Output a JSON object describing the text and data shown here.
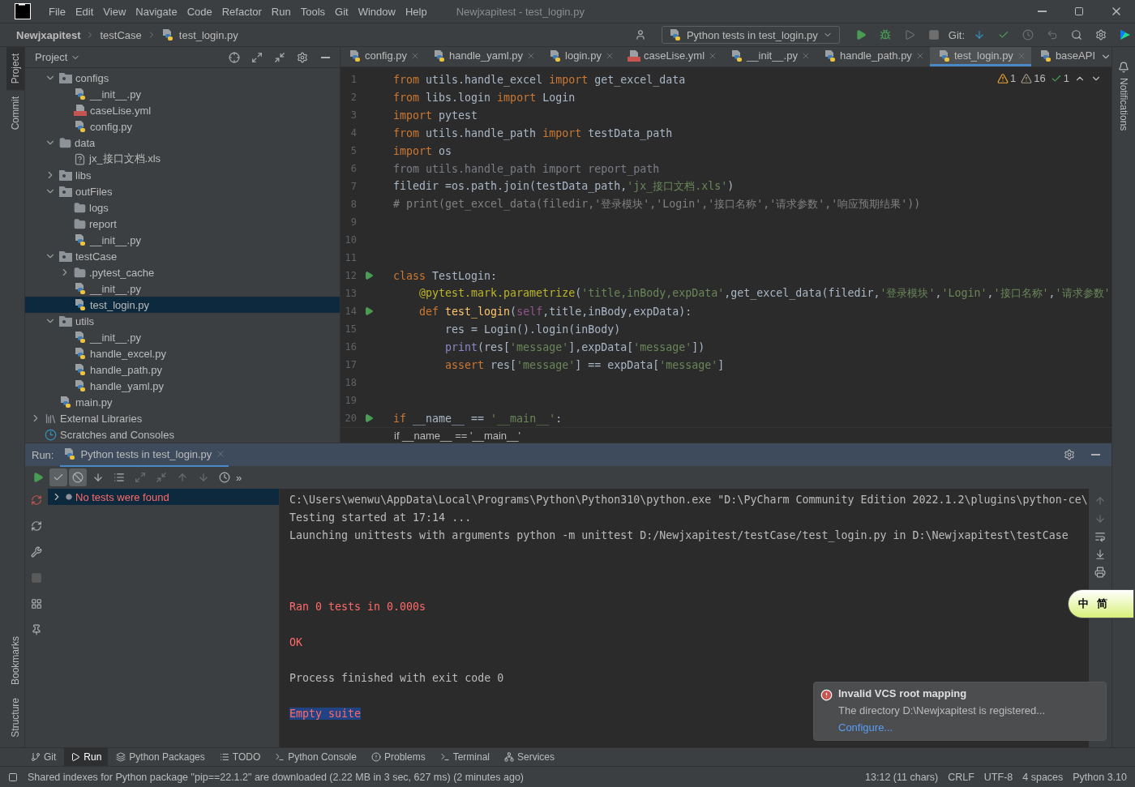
{
  "title_bar": {
    "menus": [
      "File",
      "Edit",
      "View",
      "Navigate",
      "Code",
      "Refactor",
      "Run",
      "Tools",
      "Git",
      "Window",
      "Help"
    ],
    "title": "Newjxapitest - test_login.py"
  },
  "nav_bar": {
    "breadcrumbs": [
      "Newjxapitest",
      "testCase",
      "test_login.py"
    ],
    "run_config": "Python tests in test_login.py",
    "git_label": "Git:"
  },
  "left_strip": {
    "top": [
      {
        "label": "Project",
        "selected": true
      },
      {
        "label": "Commit",
        "selected": false
      }
    ],
    "bottom": [
      {
        "label": "Bookmarks",
        "selected": false
      },
      {
        "label": "Structure",
        "selected": false
      }
    ]
  },
  "project_panel": {
    "title": "Project",
    "tree": [
      {
        "label": "configs",
        "kind": "package",
        "expanded": true,
        "selected": false,
        "children": [
          {
            "label": "__init__.py",
            "kind": "py",
            "selected": false
          },
          {
            "label": "caseLise.yml",
            "kind": "yml",
            "selected": false
          },
          {
            "label": "config.py",
            "kind": "py",
            "selected": false
          }
        ]
      },
      {
        "label": "data",
        "kind": "folder",
        "expanded": true,
        "selected": false,
        "children": [
          {
            "label": "jx_接口文档.xls",
            "kind": "unknown",
            "selected": false
          }
        ]
      },
      {
        "label": "libs",
        "kind": "package",
        "expanded": false,
        "selected": false
      },
      {
        "label": "outFiles",
        "kind": "package",
        "expanded": true,
        "selected": false,
        "children": [
          {
            "label": "logs",
            "kind": "folder",
            "selected": false
          },
          {
            "label": "report",
            "kind": "folder",
            "selected": false
          },
          {
            "label": "__init__.py",
            "kind": "py",
            "selected": false
          }
        ]
      },
      {
        "label": "testCase",
        "kind": "package",
        "expanded": true,
        "selected": false,
        "children": [
          {
            "label": ".pytest_cache",
            "kind": "folder",
            "expanded": false,
            "selected": false
          },
          {
            "label": "__init__.py",
            "kind": "py",
            "selected": false
          },
          {
            "label": "test_login.py",
            "kind": "py",
            "selected": true
          }
        ]
      },
      {
        "label": "utils",
        "kind": "package",
        "expanded": true,
        "selected": false,
        "children": [
          {
            "label": "__init__.py",
            "kind": "py",
            "selected": false
          },
          {
            "label": "handle_excel.py",
            "kind": "py",
            "selected": false
          },
          {
            "label": "handle_path.py",
            "kind": "py",
            "selected": false
          },
          {
            "label": "handle_yaml.py",
            "kind": "py",
            "selected": false
          }
        ]
      },
      {
        "label": "main.py",
        "kind": "py",
        "selected": false
      }
    ],
    "extras": [
      {
        "label": "External Libraries",
        "kind": "libs",
        "expanded": false
      },
      {
        "label": "Scratches and Consoles",
        "kind": "scratch"
      }
    ]
  },
  "editor": {
    "tabs": [
      {
        "label": "config.py",
        "kind": "py",
        "selected": false
      },
      {
        "label": "handle_yaml.py",
        "kind": "py",
        "selected": false
      },
      {
        "label": "login.py",
        "kind": "py",
        "selected": false
      },
      {
        "label": "caseLise.yml",
        "kind": "yml",
        "selected": false
      },
      {
        "label": "__init__.py",
        "kind": "py",
        "selected": false
      },
      {
        "label": "handle_path.py",
        "kind": "py",
        "selected": false
      },
      {
        "label": "test_login.py",
        "kind": "py",
        "selected": true
      },
      {
        "label": "baseAPI",
        "kind": "py",
        "selected": false
      }
    ],
    "inspections": [
      {
        "kind": "warning",
        "count": "1"
      },
      {
        "kind": "weak",
        "count": "16"
      },
      {
        "kind": "typo",
        "count": "1"
      }
    ],
    "lines": [
      {
        "number": "1",
        "run": false,
        "tokens": [
          {
            "kind": "kw",
            "text": "from"
          },
          {
            "kind": "plain",
            "text": " utils.handle_excel "
          },
          {
            "kind": "kw",
            "text": "import"
          },
          {
            "kind": "plain",
            "text": " get_excel_data"
          }
        ]
      },
      {
        "number": "2",
        "run": false,
        "tokens": [
          {
            "kind": "kw",
            "text": "from"
          },
          {
            "kind": "plain",
            "text": " libs.login "
          },
          {
            "kind": "kw",
            "text": "import"
          },
          {
            "kind": "plain",
            "text": " Login"
          }
        ]
      },
      {
        "number": "3",
        "run": false,
        "tokens": [
          {
            "kind": "kw",
            "text": "import"
          },
          {
            "kind": "plain",
            "text": " pytest"
          }
        ]
      },
      {
        "number": "4",
        "run": false,
        "tokens": [
          {
            "kind": "kw",
            "text": "from"
          },
          {
            "kind": "plain",
            "text": " utils.handle_path "
          },
          {
            "kind": "kw",
            "text": "import"
          },
          {
            "kind": "plain",
            "text": " testData_path"
          }
        ]
      },
      {
        "number": "5",
        "run": false,
        "tokens": [
          {
            "kind": "kw",
            "text": "import"
          },
          {
            "kind": "plain",
            "text": " os"
          }
        ]
      },
      {
        "number": "6",
        "run": false,
        "tokens": [
          {
            "kind": "dim",
            "text": "from utils.handle_path import report_path"
          }
        ]
      },
      {
        "number": "7",
        "run": false,
        "tokens": [
          {
            "kind": "plain",
            "text": "filedir =os.path.join(testData_path,"
          },
          {
            "kind": "str",
            "text": "'jx_接口文档.xls'"
          },
          {
            "kind": "plain",
            "text": ")"
          }
        ]
      },
      {
        "number": "8",
        "run": false,
        "tokens": [
          {
            "kind": "comment",
            "text": "# print(get_excel_data(filedir,'登录模块','Login','接口名称','请求参数','响应预期结果'))"
          }
        ]
      },
      {
        "number": "9",
        "run": false
      },
      {
        "number": "10",
        "run": false
      },
      {
        "number": "11",
        "run": false
      },
      {
        "number": "12",
        "run": true,
        "tokens": [
          {
            "kind": "kw",
            "text": "class"
          },
          {
            "kind": "plain",
            "text": " TestLogin:"
          }
        ]
      },
      {
        "number": "13",
        "run": false,
        "tokens": [
          {
            "kind": "deco",
            "text": "    @pytest.mark.parametrize"
          },
          {
            "kind": "plain",
            "text": "("
          },
          {
            "kind": "str",
            "text": "'title,inBody,expData'"
          },
          {
            "kind": "plain",
            "text": ",get_excel_data(filedir,"
          },
          {
            "kind": "str",
            "text": "'登录模块'"
          },
          {
            "kind": "plain",
            "text": ","
          },
          {
            "kind": "str",
            "text": "'Login'"
          },
          {
            "kind": "plain",
            "text": ","
          },
          {
            "kind": "str",
            "text": "'接口名称'"
          },
          {
            "kind": "plain",
            "text": ","
          },
          {
            "kind": "str",
            "text": "'请求参数'"
          }
        ]
      },
      {
        "number": "14",
        "run": true,
        "tokens": [
          {
            "kind": "kw",
            "text": "    def "
          },
          {
            "kind": "fn",
            "text": "test_login"
          },
          {
            "kind": "plain",
            "text": "("
          },
          {
            "kind": "self",
            "text": "self"
          },
          {
            "kind": "plain",
            "text": ",title,inBody,expData):"
          }
        ]
      },
      {
        "number": "15",
        "run": false,
        "tokens": [
          {
            "kind": "plain",
            "text": "        res = Login().login(inBody)"
          }
        ]
      },
      {
        "number": "16",
        "run": false,
        "tokens": [
          {
            "kind": "builtin",
            "text": "        print"
          },
          {
            "kind": "plain",
            "text": "(res["
          },
          {
            "kind": "str",
            "text": "'message'"
          },
          {
            "kind": "plain",
            "text": "],expData["
          },
          {
            "kind": "str",
            "text": "'message'"
          },
          {
            "kind": "plain",
            "text": "])"
          }
        ]
      },
      {
        "number": "17",
        "run": false,
        "tokens": [
          {
            "kind": "kw",
            "text": "        assert"
          },
          {
            "kind": "plain",
            "text": " res["
          },
          {
            "kind": "str",
            "text": "'message'"
          },
          {
            "kind": "plain",
            "text": "] == expData["
          },
          {
            "kind": "str",
            "text": "'message'"
          },
          {
            "kind": "plain",
            "text": "]"
          }
        ]
      },
      {
        "number": "18",
        "run": false
      },
      {
        "number": "19",
        "run": false
      },
      {
        "number": "20",
        "run": true,
        "tokens": [
          {
            "kind": "kw",
            "text": "if"
          },
          {
            "kind": "plain",
            "text": " __name__ == "
          },
          {
            "kind": "str",
            "text": "'__main__'"
          },
          {
            "kind": "plain",
            "text": ":"
          }
        ]
      }
    ],
    "breadcrumb": "if __name__ == '__main__'"
  },
  "right_strip": {
    "label": "Notifications"
  },
  "run_panel": {
    "label": "Run:",
    "tab": "Python tests in test_login.py",
    "filter_toggles": [
      {
        "on": true
      },
      {
        "on": true
      }
    ],
    "more": "»",
    "tree": [
      {
        "label": "No tests were found",
        "selected": true
      }
    ],
    "console": [
      {
        "kind": "plain",
        "text": "C:\\Users\\wenwu\\AppData\\Local\\Programs\\Python\\Python310\\python.exe \"D:\\PyCharm Community Edition 2022.1.2\\plugins\\python-ce\\"
      },
      {
        "kind": "plain",
        "text": "Testing started at 17:14 ..."
      },
      {
        "kind": "plain",
        "text": "Launching unittests with arguments python -m unittest D:/Newjxapitest/testCase/test_login.py in D:\\Newjxapitest\\testCase"
      },
      {
        "kind": "blank"
      },
      {
        "kind": "blank"
      },
      {
        "kind": "blank"
      },
      {
        "kind": "error",
        "text": "Ran 0 tests in 0.000s"
      },
      {
        "kind": "blank"
      },
      {
        "kind": "error",
        "text": "OK"
      },
      {
        "kind": "blank"
      },
      {
        "kind": "plain",
        "text": "Process finished with exit code 0"
      },
      {
        "kind": "blank"
      },
      {
        "kind": "highlight",
        "text": "Empty suite"
      }
    ]
  },
  "notification": {
    "title": "Invalid VCS root mapping",
    "body": "The directory D:\\Newjxapitest is registered...",
    "link": "Configure..."
  },
  "ime_widget": {
    "labels": [
      "中",
      "简"
    ]
  },
  "tool_tabs": [
    {
      "label": "Git",
      "selected": false
    },
    {
      "label": "Run",
      "selected": true
    },
    {
      "label": "Python Packages",
      "selected": false
    },
    {
      "label": "TODO",
      "selected": false
    },
    {
      "label": "Python Console",
      "selected": false
    },
    {
      "label": "Problems",
      "selected": false
    },
    {
      "label": "Terminal",
      "selected": false
    },
    {
      "label": "Services",
      "selected": false
    }
  ],
  "status_bar": {
    "message": "Shared indexes for Python package \"pip==22.1.2\" are downloaded (2.22 MB in 3 sec, 627 ms) (2 minutes ago)",
    "items": [
      "13:12 (11 chars)",
      "CRLF",
      "UTF-8",
      "4 spaces",
      "Python 3.10"
    ]
  }
}
